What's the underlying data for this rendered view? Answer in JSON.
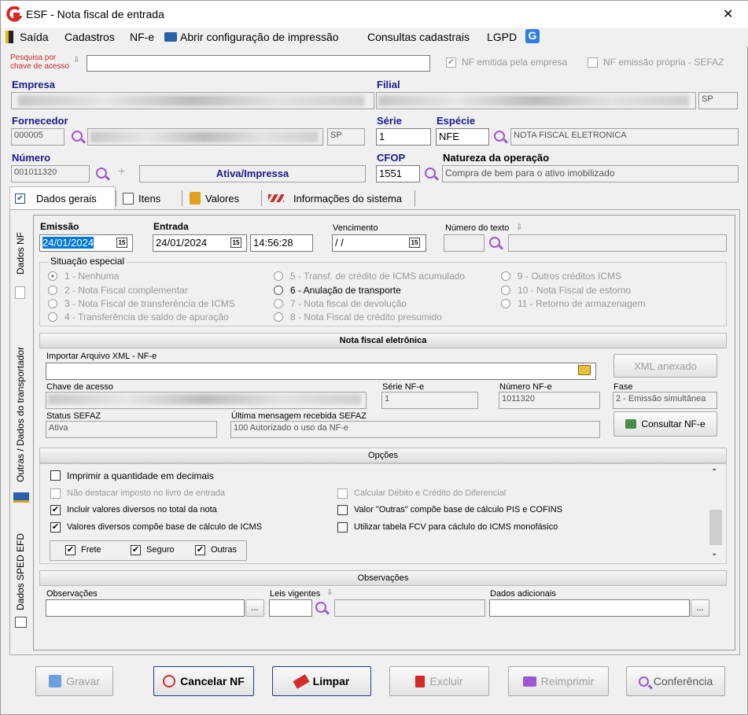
{
  "window": {
    "title": "ESF - Nota fiscal de entrada",
    "close": "✕"
  },
  "menu": {
    "saida": "Saída",
    "cadastros": "Cadastros",
    "nfe": "NF-e",
    "abrir": "Abrir configuração de impressão",
    "consultas": "Consultas cadastrais",
    "lgpd": "LGPD"
  },
  "search": {
    "label": "Pesquisa por\nchave de acesso",
    "value": "",
    "nf_emitida": "NF emitida pela empresa",
    "nf_propria": "NF emissão própria - SEFAZ"
  },
  "empresa": {
    "label": "Empresa"
  },
  "filial": {
    "label": "Filial",
    "uf": "SP"
  },
  "fornecedor": {
    "label": "Fornecedor",
    "code": "000005",
    "uf": "SP"
  },
  "serie": {
    "label": "Série",
    "value": "1"
  },
  "especie": {
    "label": "Espécie",
    "value": "NFE",
    "desc": "NOTA FISCAL ELETRONICA"
  },
  "numero": {
    "label": "Número",
    "value": "001011320",
    "status": "Ativa/Impressa"
  },
  "cfop": {
    "label": "CFOP",
    "value": "1551"
  },
  "natureza": {
    "label": "Natureza da operação",
    "value": "Compra de bem para o ativo imobilizado"
  },
  "tabs": {
    "dados_gerais": "Dados gerais",
    "itens": "Itens",
    "valores": "Valores",
    "info": "Informações do sistema"
  },
  "side_tabs": {
    "dados_nf": "Dados NF",
    "transportador": "Outras / Dados do transportador",
    "sped": "Dados SPED EFD"
  },
  "dates": {
    "emissao_label": "Emissão",
    "emissao": "24/01/2024",
    "entrada_label": "Entrada",
    "entrada": "24/01/2024",
    "hora": "14:56:28",
    "venc_label": "Vencimento",
    "venc": " / /",
    "num_texto_label": "Número do texto",
    "cal_icon": "15"
  },
  "situacao": {
    "title": "Situação especial",
    "options": [
      "1 - Nenhuma",
      "2 - Nota Fiscal complementar",
      "3 - Nota Fiscal de transferência de ICMS",
      "4 - Transferência de saldo de apuração",
      "5 - Transf. de crédito de ICMS acumulado",
      "6 - Anulação de transporte",
      "7 - Nota fiscal de devolução",
      "8 - Nota Fiscal de crédito presumido",
      "9 - Outros créditos ICMS",
      "10 - Nota Fiscal de estorno",
      "11 - Retorno de armazenagem"
    ]
  },
  "nfe": {
    "header": "Nota fiscal eletrônica",
    "importar_label": "Importar Arquivo XML - NF-e",
    "xml_btn": "XML anexado",
    "chave_label": "Chave de acesso",
    "serie_label": "Série NF-e",
    "serie": "1",
    "numero_label": "Número NF-e",
    "numero": "1011320",
    "fase_label": "Fase",
    "fase": "2 - Emissão simultânea",
    "status_label": "Status SEFAZ",
    "status": "Ativa",
    "msg_label": "Última mensagem recebida SEFAZ",
    "msg": "100 Autorizado o uso da NF-e",
    "consultar": "Consultar NF-e"
  },
  "opcoes": {
    "header": "Opções",
    "items": [
      {
        "label": "Imprimir a quantidade em decimais",
        "checked": false,
        "enabled": true
      },
      {
        "label": "Não destacar imposto no livro de entrada",
        "checked": false,
        "enabled": false
      },
      {
        "label": "Incluir valores diversos no total da nota",
        "checked": true,
        "enabled": true
      },
      {
        "label": "Valores diversos compõe base de cálculo de ICMS",
        "checked": true,
        "enabled": true
      },
      {
        "label": "Calcular Débito e Crédito do Diferencial",
        "checked": false,
        "enabled": false
      },
      {
        "label": "Valor \"Outras\" compõe base de cálculo PIS e COFINS",
        "checked": false,
        "enabled": true
      },
      {
        "label": "Utilizar tabela FCV para cáclulo do ICMS monofásico",
        "checked": false,
        "enabled": true
      }
    ],
    "frete": "Frete",
    "seguro": "Seguro",
    "outras": "Outras",
    "check": "✔"
  },
  "obs": {
    "header": "Observações",
    "obs_label": "Observações",
    "leis_label": "Leis vigentes",
    "dados_label": "Dados adicionais",
    "ellipsis": "..."
  },
  "buttons": {
    "gravar": "Gravar",
    "cancelar": "Cancelar NF",
    "limpar": "Limpar",
    "excluir": "Excluir",
    "reimprimir": "Reimprimir",
    "conferencia": "Conferência"
  },
  "colors": {
    "brand_red": "#d42a2a",
    "label_blue": "#1a1a8c",
    "magnifier": "#9b59d0"
  }
}
